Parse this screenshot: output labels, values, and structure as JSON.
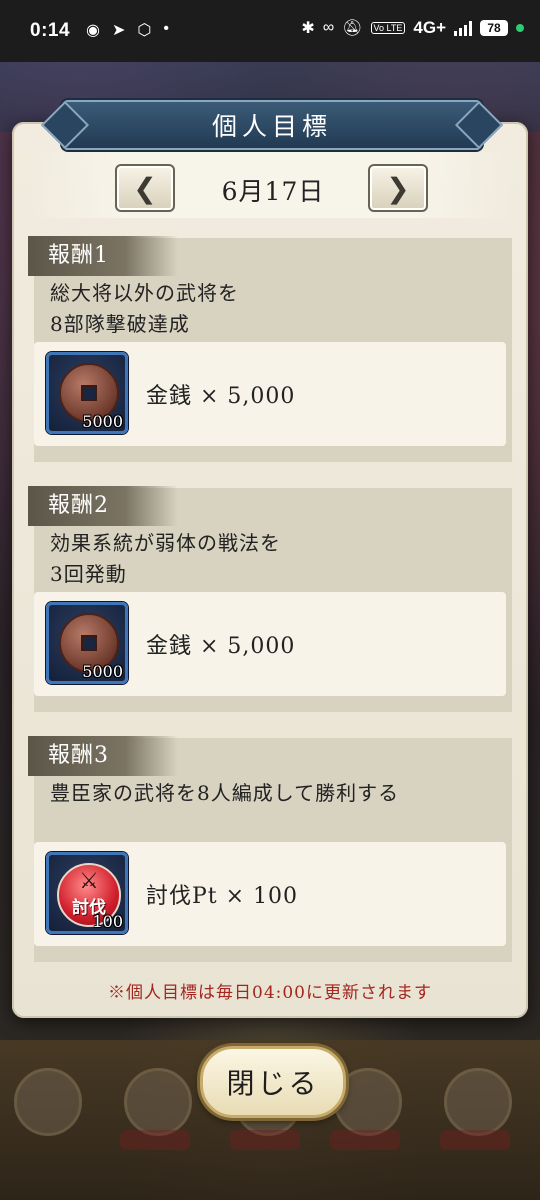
{
  "status_bar": {
    "time": "0:14",
    "network": "4G+",
    "volte": "Vo LTE",
    "battery": "78"
  },
  "dialog": {
    "title": "個人目標",
    "date": "6月17日",
    "prev_arrow": "❮",
    "next_arrow": "❯",
    "rewards": [
      {
        "label": "報酬1",
        "description": "総大将以外の武将を\n8部隊撃破達成",
        "item_icon": "coin-icon",
        "item_qty": "5000",
        "item_text": "金銭 × 5,000"
      },
      {
        "label": "報酬2",
        "description": "効果系統が弱体の戦法を\n3回発動",
        "item_icon": "coin-icon",
        "item_qty": "5000",
        "item_text": "金銭 × 5,000"
      },
      {
        "label": "報酬3",
        "description": "豊臣家の武将を8人編成して勝利する",
        "item_icon": "subjugation-badge-icon",
        "item_badge_text": "討伐",
        "item_qty": "100",
        "item_text": "討伐Pt × 100"
      }
    ],
    "footer_note": "※個人目標は毎日04:00に更新されます",
    "close_label": "閉じる"
  },
  "colors": {
    "banner": "#2c4a66",
    "note_red": "#a3261f",
    "icon_border": "#3f76b8"
  }
}
